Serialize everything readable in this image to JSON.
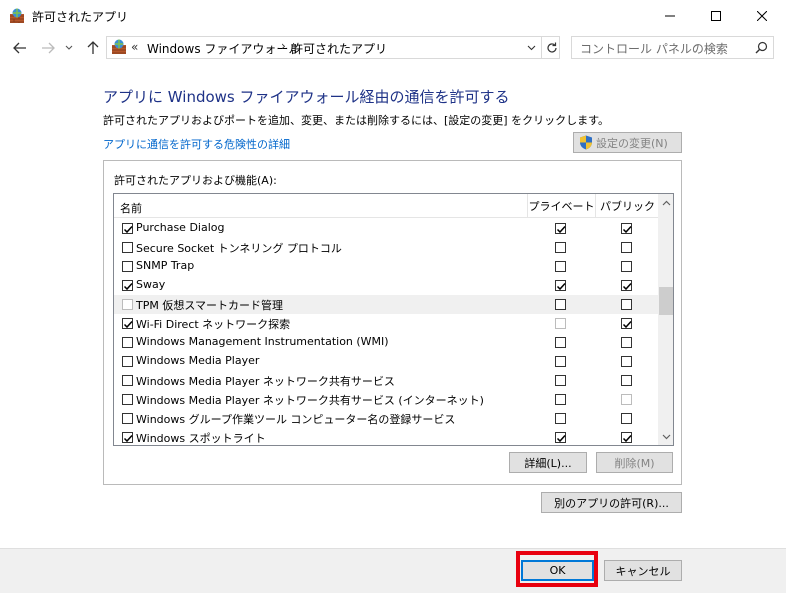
{
  "window": {
    "title": "許可されたアプリ"
  },
  "address": {
    "chevrons": "«",
    "crumb1": "Windows ファイアウォール",
    "separator": "›",
    "crumb2": "許可されたアプリ",
    "search_placeholder": "コントロール パネルの検索"
  },
  "main": {
    "heading": "アプリに Windows ファイアウォール経由の通信を許可する",
    "subtext": "許可されたアプリおよびポートを追加、変更、または削除するには、[設定の変更] をクリックします。",
    "risk_link": "アプリに通信を許可する危険性の詳細",
    "change_settings": "設定の変更(N)"
  },
  "list": {
    "group_label": "許可されたアプリおよび機能(A):",
    "col_name": "名前",
    "col_private": "プライベート",
    "col_public": "パブリック",
    "rows": [
      {
        "name": "Purchase Dialog",
        "enabled": true,
        "private": true,
        "public": true
      },
      {
        "name": "Secure Socket トンネリング プロトコル",
        "enabled": false,
        "private": false,
        "public": false
      },
      {
        "name": "SNMP Trap",
        "enabled": false,
        "private": false,
        "public": false
      },
      {
        "name": "Sway",
        "enabled": true,
        "private": true,
        "public": true
      },
      {
        "name": "TPM 仮想スマートカード管理",
        "enabled": false,
        "private": false,
        "public": false,
        "selected": true
      },
      {
        "name": "Wi-Fi Direct ネットワーク探索",
        "enabled": true,
        "private": false,
        "public": true,
        "private_dim": true
      },
      {
        "name": "Windows Management Instrumentation (WMI)",
        "enabled": false,
        "private": false,
        "public": false
      },
      {
        "name": "Windows Media Player",
        "enabled": false,
        "private": false,
        "public": false
      },
      {
        "name": "Windows Media Player ネットワーク共有サービス",
        "enabled": false,
        "private": false,
        "public": false
      },
      {
        "name": "Windows Media Player ネットワーク共有サービス (インターネット)",
        "enabled": false,
        "private": false,
        "public": false,
        "public_dim": true
      },
      {
        "name": "Windows グループ作業ツール コンピューター名の登録サービス",
        "enabled": false,
        "private": false,
        "public": false
      },
      {
        "name": "Windows スポットライト",
        "enabled": true,
        "private": true,
        "public": true
      }
    ],
    "details_button": "詳細(L)...",
    "remove_button": "削除(M)"
  },
  "other_app_button": "別のアプリの許可(R)...",
  "footer": {
    "ok": "OK",
    "cancel": "キャンセル"
  },
  "colors": {
    "heading": "#1e3287",
    "link": "#0066cc",
    "highlight": "#e8000f"
  }
}
